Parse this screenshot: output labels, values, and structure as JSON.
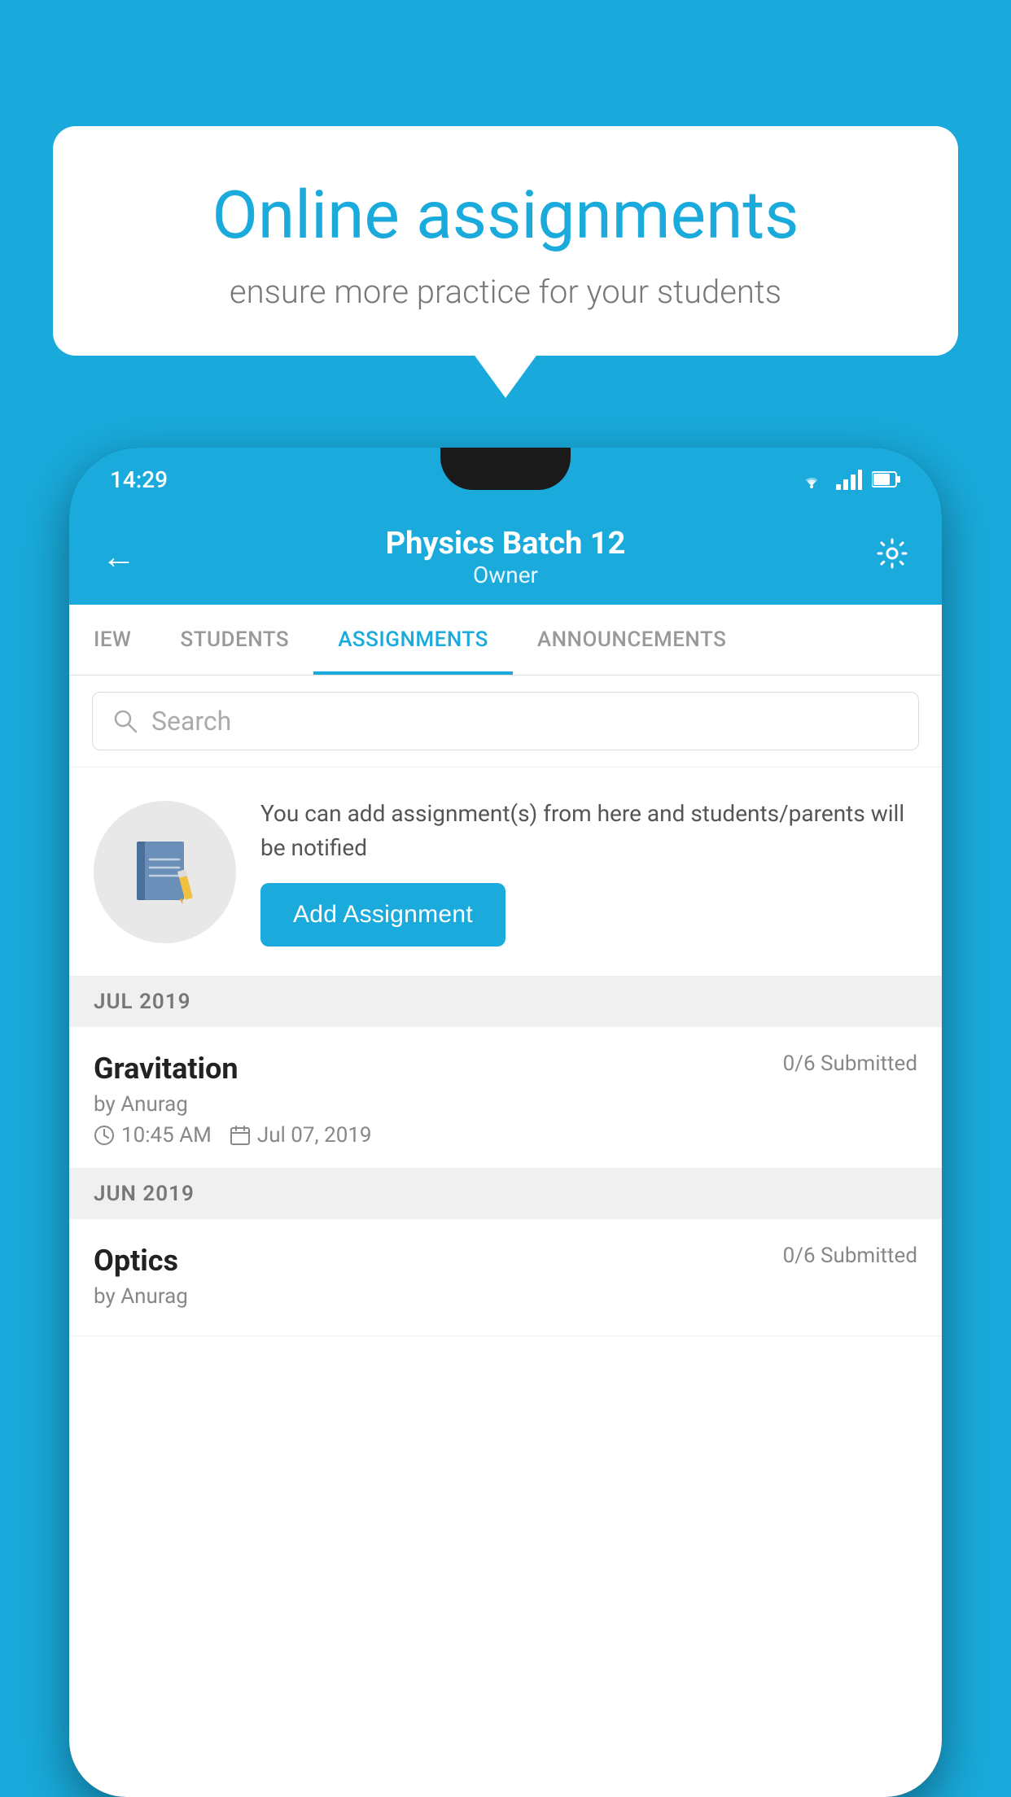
{
  "background_color": "#19AADB",
  "speech_bubble": {
    "title": "Online assignments",
    "subtitle": "ensure more practice for your students"
  },
  "phone": {
    "status_bar": {
      "time": "14:29",
      "icons": [
        "wifi",
        "signal",
        "battery"
      ]
    },
    "header": {
      "title": "Physics Batch 12",
      "subtitle": "Owner",
      "back_label": "←",
      "settings_label": "⚙"
    },
    "tabs": [
      {
        "label": "IEW",
        "active": false
      },
      {
        "label": "STUDENTS",
        "active": false
      },
      {
        "label": "ASSIGNMENTS",
        "active": true
      },
      {
        "label": "ANNOUNCEMENTS",
        "active": false
      }
    ],
    "search": {
      "placeholder": "Search"
    },
    "promo": {
      "icon": "📓",
      "description": "You can add assignment(s) from here and students/parents will be notified",
      "button_label": "Add Assignment"
    },
    "sections": [
      {
        "month": "JUL 2019",
        "assignments": [
          {
            "name": "Gravitation",
            "submitted": "0/6 Submitted",
            "by": "by Anurag",
            "time": "10:45 AM",
            "date": "Jul 07, 2019"
          }
        ]
      },
      {
        "month": "JUN 2019",
        "assignments": [
          {
            "name": "Optics",
            "submitted": "0/6 Submitted",
            "by": "by Anurag",
            "time": "",
            "date": ""
          }
        ]
      }
    ]
  }
}
